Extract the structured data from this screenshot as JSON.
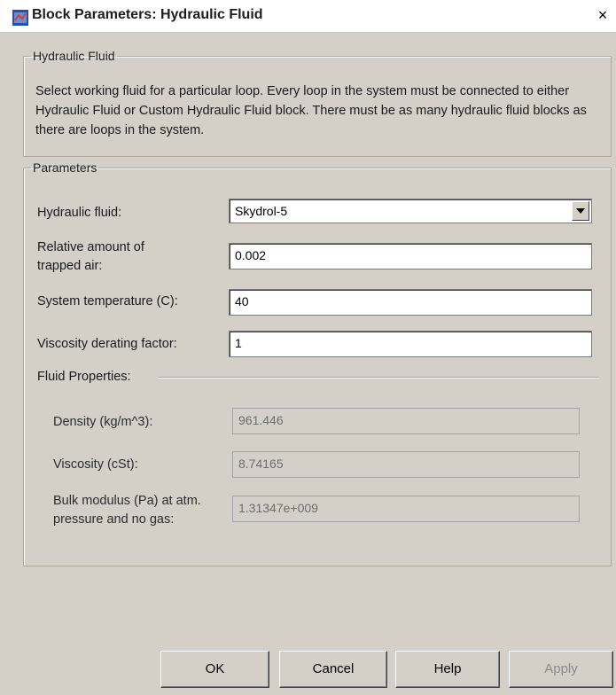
{
  "window": {
    "title": "Block Parameters: Hydraulic Fluid",
    "close_glyph": "×"
  },
  "description_group": {
    "legend": "Hydraulic Fluid",
    "text": "Select working fluid for a particular loop. Every loop in the system must be connected to either Hydraulic Fluid or Custom Hydraulic Fluid block. There must be as many hydraulic fluid blocks as there are loops in the system."
  },
  "parameters": {
    "legend": "Parameters",
    "hydraulic_fluid": {
      "label": "Hydraulic fluid:",
      "value": "Skydrol-5"
    },
    "trapped_air": {
      "label_line1": "Relative amount of",
      "label_line2": "trapped air:",
      "value": "0.002"
    },
    "system_temperature": {
      "label": "System temperature (C):",
      "value": "40"
    },
    "viscosity_derating": {
      "label": "Viscosity derating factor:",
      "value": "1"
    },
    "fluid_properties": {
      "label": "Fluid Properties:",
      "density": {
        "label": "Density (kg/m^3):",
        "value": "961.446"
      },
      "viscosity": {
        "label": "Viscosity (cSt):",
        "value": "8.74165"
      },
      "bulk_modulus": {
        "label_line1": "Bulk modulus (Pa) at atm.",
        "label_line2": "pressure and no gas:",
        "value": "1.31347e+009"
      }
    }
  },
  "buttons": {
    "ok": "OK",
    "cancel": "Cancel",
    "help": "Help",
    "apply": "Apply"
  }
}
